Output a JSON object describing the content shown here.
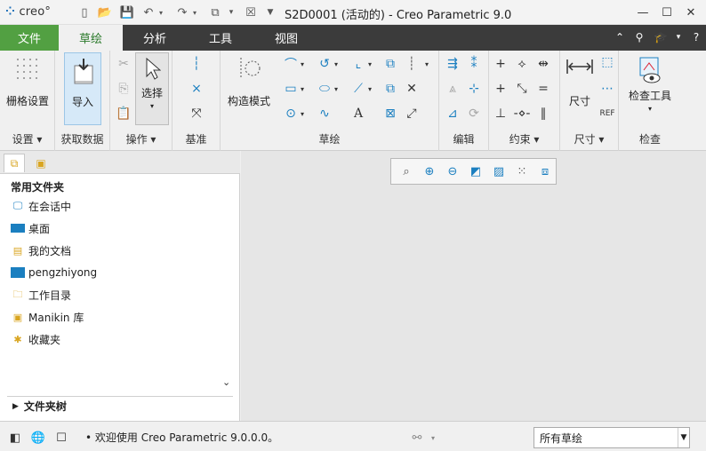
{
  "app": {
    "logo": "creo",
    "window_title": "S2D0001 (活动的) - Creo Parametric 9.0"
  },
  "tabs": [
    {
      "label": "文件"
    },
    {
      "label": "草绘"
    },
    {
      "label": "分析"
    },
    {
      "label": "工具"
    },
    {
      "label": "视图"
    }
  ],
  "ribbon": {
    "groups": {
      "settings": "设置",
      "get_data": "获取数据",
      "operations": "操作",
      "datum": "基准",
      "sketch": "草绘",
      "edit": "编辑",
      "constrain": "约束",
      "dimension": "尺寸",
      "inspect": "检查"
    },
    "grid_settings": "栅格设置",
    "import": "导入",
    "select": "选择",
    "construction_mode": "构造模式",
    "dimension_btn": "尺寸",
    "inspect_tools": "检查工具"
  },
  "folders": {
    "title": "常用文件夹",
    "items": [
      {
        "label": "在会话中"
      },
      {
        "label": "桌面"
      },
      {
        "label": "我的文档"
      },
      {
        "label": "pengzhiyong"
      },
      {
        "label": "工作目录"
      },
      {
        "label": "Manikin 库"
      },
      {
        "label": "收藏夹"
      }
    ],
    "tree_label": "文件夹树"
  },
  "status": {
    "message": "欢迎使用 Creo Parametric 9.0.0.0。",
    "filter": "所有草绘"
  },
  "colors": {
    "file_tab": "#52a042",
    "tab_bar": "#3b3b3b",
    "icon_blue": "#1b7fc0"
  }
}
